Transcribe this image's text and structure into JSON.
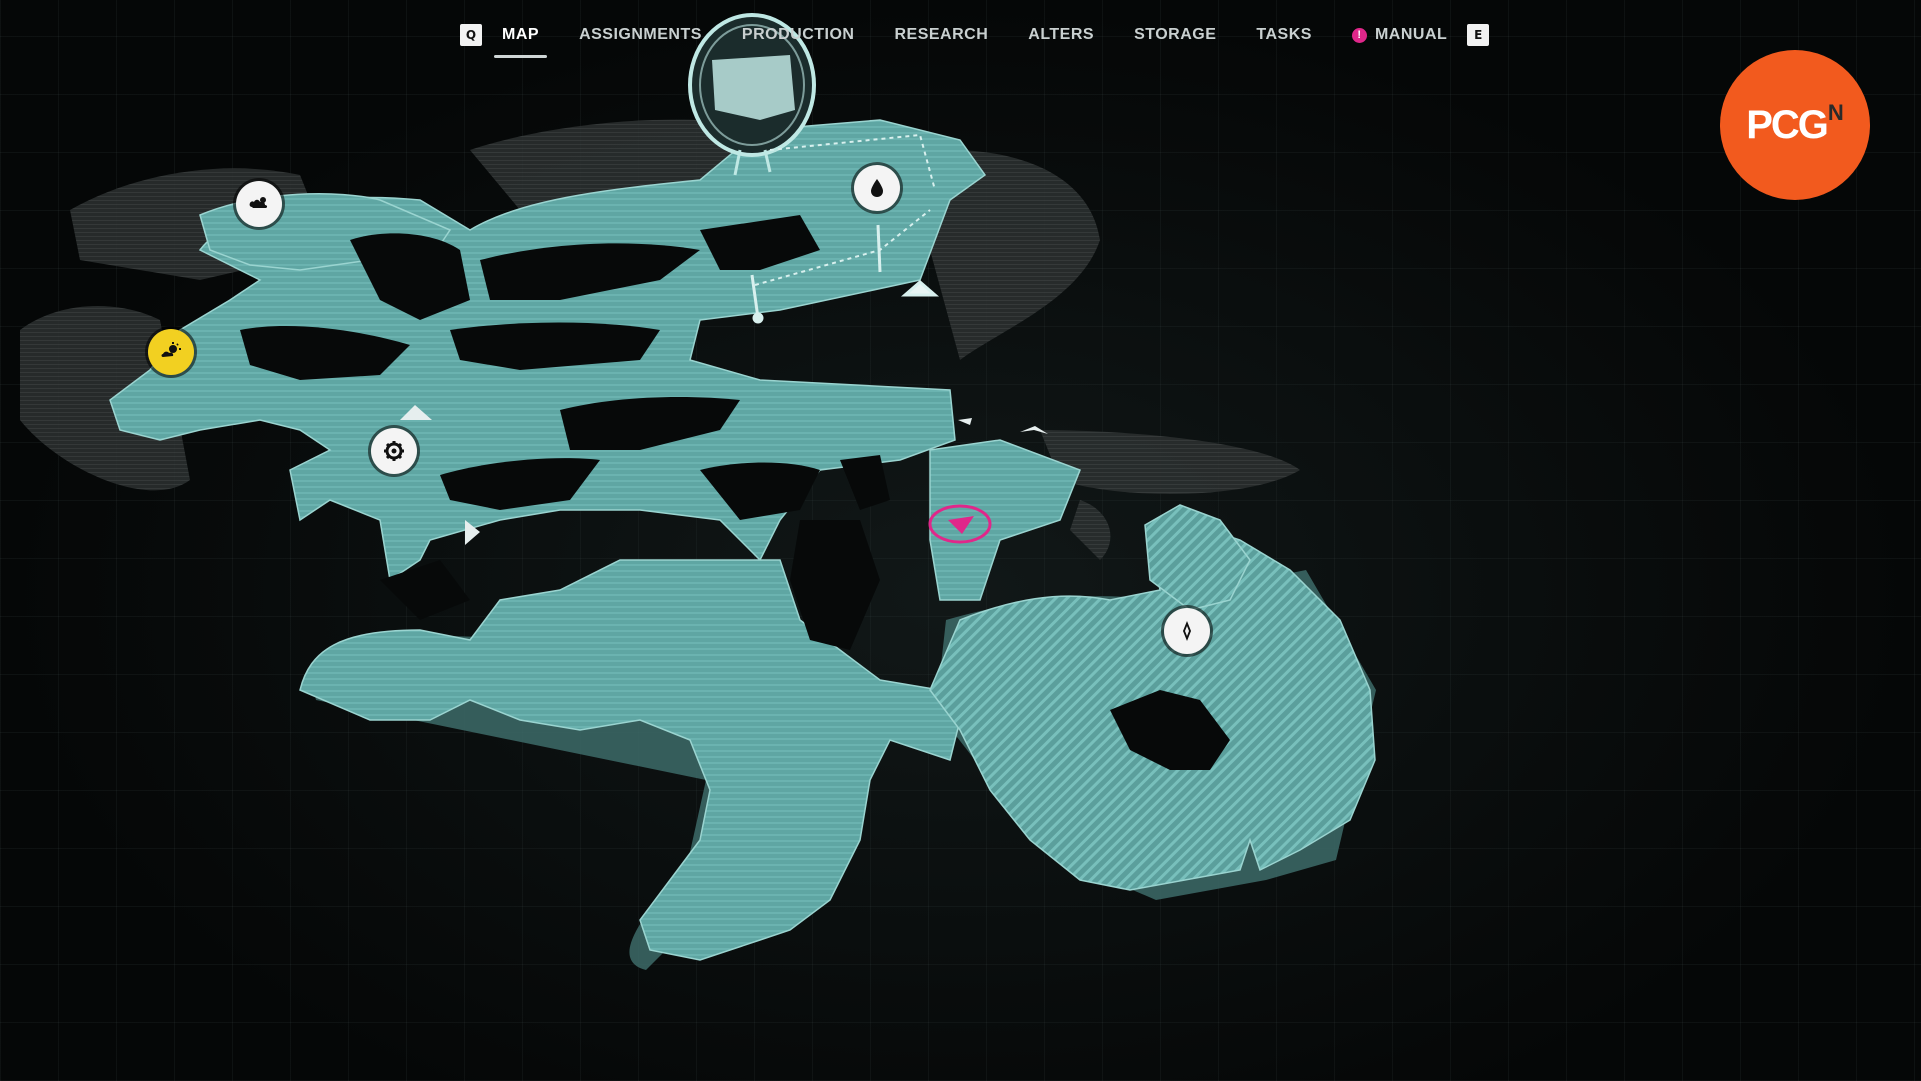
{
  "nav": {
    "prev_key": "Q",
    "next_key": "E",
    "tabs": [
      {
        "label": "MAP",
        "active": true
      },
      {
        "label": "ASSIGNMENTS",
        "active": false
      },
      {
        "label": "PRODUCTION",
        "active": false
      },
      {
        "label": "RESEARCH",
        "active": false
      },
      {
        "label": "ALTERS",
        "active": false
      },
      {
        "label": "STORAGE",
        "active": false
      },
      {
        "label": "TASKS",
        "active": false
      },
      {
        "label": "MANUAL",
        "active": false
      }
    ],
    "manual_badge": "!"
  },
  "logo": {
    "text": "PCG",
    "superscript": "N"
  },
  "markers": [
    {
      "icon": "resource-cloud-icon",
      "color": "#f4f4f4"
    },
    {
      "icon": "sun-cloud-icon",
      "color": "#f2d021"
    },
    {
      "icon": "gear-icon",
      "color": "#f4f4f4"
    },
    {
      "icon": "water-drop-icon",
      "color": "#f4f4f4"
    },
    {
      "icon": "compass-icon",
      "color": "#f4f4f4"
    }
  ],
  "player": {
    "icon": "player-location-icon",
    "color": "#e0278a"
  },
  "colors": {
    "land": "#5fa6a3",
    "land_edge": "#3d6b69",
    "fog": "#2a2e2e",
    "accent": "#e0278a",
    "logo": "#f25a1e"
  }
}
